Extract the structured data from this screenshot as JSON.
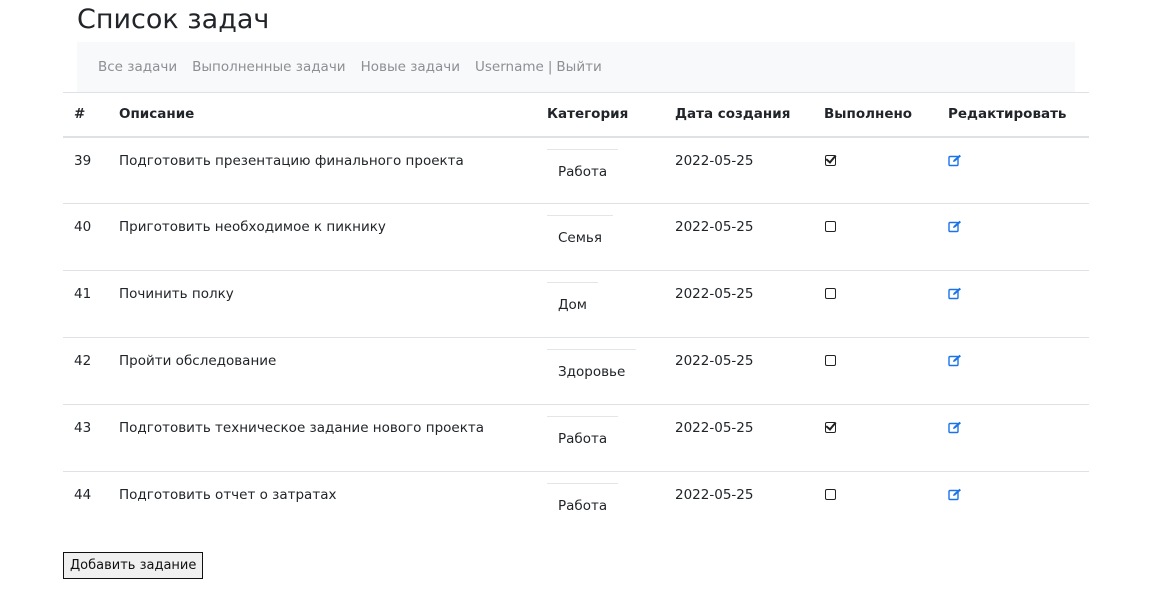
{
  "page": {
    "title": "Список задач"
  },
  "nav": {
    "links": [
      "Все задачи",
      "Выполненные задачи",
      "Новые задачи"
    ],
    "username": "Username",
    "separator": "|",
    "logout": "Выйти"
  },
  "table": {
    "headers": {
      "id": "#",
      "description": "Описание",
      "category": "Категория",
      "created": "Дата создания",
      "done": "Выполнено",
      "edit": "Редактировать"
    },
    "rows": [
      {
        "id": "39",
        "description": "Подготовить презентацию финального проекта",
        "category": "Работа",
        "created": "2022-05-25",
        "done": true
      },
      {
        "id": "40",
        "description": "Приготовить необходимое к пикнику",
        "category": "Семья",
        "created": "2022-05-25",
        "done": false
      },
      {
        "id": "41",
        "description": "Починить полку",
        "category": "Дом",
        "created": "2022-05-25",
        "done": false
      },
      {
        "id": "42",
        "description": "Пройти обследование",
        "category": "Здоровье",
        "created": "2022-05-25",
        "done": false
      },
      {
        "id": "43",
        "description": "Подготовить техническое задание нового проекта",
        "category": "Работа",
        "created": "2022-05-25",
        "done": true
      },
      {
        "id": "44",
        "description": "Подготовить отчет о затратах",
        "category": "Работа",
        "created": "2022-05-25",
        "done": false
      }
    ],
    "edit_icon": "edit-icon",
    "edit_icon_color": "#1a73e8"
  },
  "actions": {
    "add_label": "Добавить задание"
  }
}
